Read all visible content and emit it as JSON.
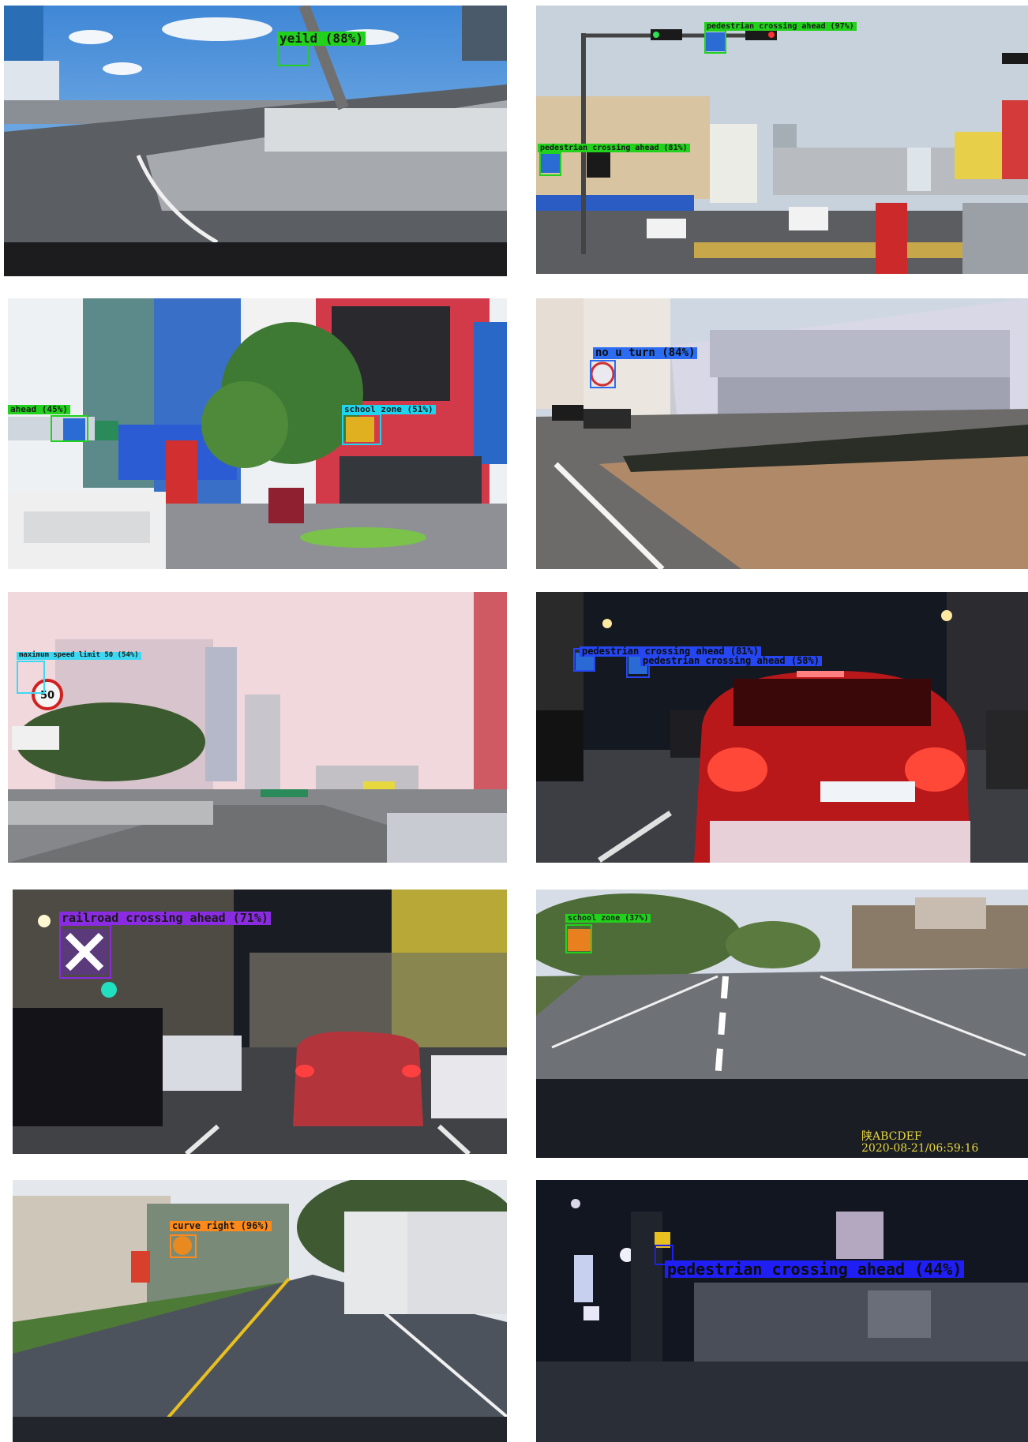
{
  "panels": [
    {
      "detections": [
        {
          "label": "yeild (88%)",
          "color": "#22d11c",
          "text_color": "#1a1a1a"
        }
      ]
    },
    {
      "detections": [
        {
          "label": "pedestrian crossing ahead (97%)",
          "color": "#22d11c",
          "text_color": "#1a1a1a"
        },
        {
          "label": "pedestrian crossing ahead (81%)",
          "color": "#22d11c",
          "text_color": "#1a1a1a"
        }
      ]
    },
    {
      "detections": [
        {
          "label": "ahead (45%)",
          "color": "#22d11c",
          "text_color": "#1a1a1a"
        },
        {
          "label": "school zone (51%)",
          "color": "#1fd4ee",
          "text_color": "#1a1a1a"
        }
      ]
    },
    {
      "detections": [
        {
          "label": "no u turn (84%)",
          "color": "#2b6cf2",
          "text_color": "#0d0d0d"
        }
      ]
    },
    {
      "detections": [
        {
          "label": "maximum speed limit 50 (54%)",
          "color": "#3fd8f2",
          "text_color": "#1a1a1a"
        }
      ]
    },
    {
      "detections": [
        {
          "label": "pedestrian crossing ahead (81%)",
          "color": "#2546f0",
          "text_color": "#0d0d0d"
        },
        {
          "label": "pedestrian crossing ahead (58%)",
          "color": "#2546f0",
          "text_color": "#0d0d0d"
        }
      ]
    },
    {
      "detections": [
        {
          "label": "railroad crossing ahead (71%)",
          "color": "#8a2be2",
          "text_color": "#1a1a1a"
        }
      ]
    },
    {
      "detections": [
        {
          "label": "school zone (37%)",
          "color": "#22d11c",
          "text_color": "#1a1a1a"
        }
      ],
      "stamp_line1": "陕ABCDEF",
      "stamp_line2": "2020-08-21/06:59:16"
    },
    {
      "detections": [
        {
          "label": "curve right (96%)",
          "color": "#ff8a1a",
          "text_color": "#1a1a1a"
        }
      ]
    },
    {
      "detections": [
        {
          "label": "pedestrian crossing ahead (44%)",
          "color": "#1e1ef5",
          "text_color": "#0d0d0d"
        }
      ]
    }
  ]
}
